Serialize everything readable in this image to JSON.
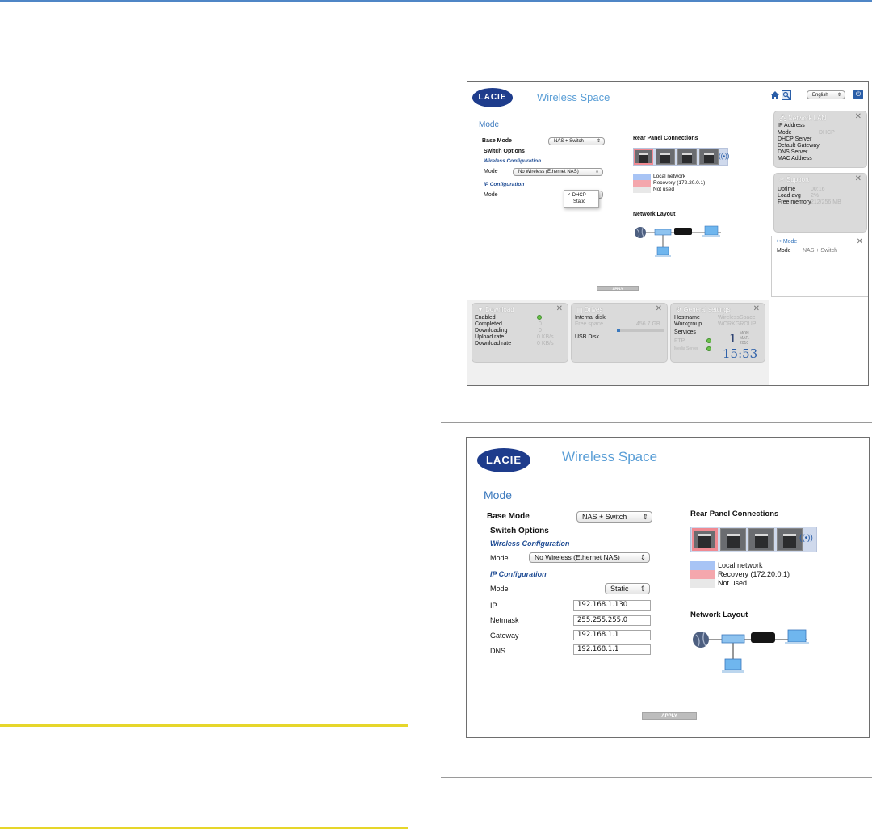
{
  "brand": {
    "logo": "LACIE",
    "product": "Wireless Space"
  },
  "colors": {
    "accent": "#3a78bd",
    "logo_bg": "#1e3c8c",
    "local_network": "#a8c4f5",
    "recovery": "#f4a7ad",
    "not_used": "#e8e8e8",
    "caution_rule": "#e6d62a"
  },
  "top": {
    "header": {
      "language": "English",
      "icons": [
        "home-icon",
        "search-icon",
        "power-icon"
      ]
    },
    "mode_title": "Mode",
    "base_mode_label": "Base Mode",
    "base_mode_value": "NAS + Switch",
    "switch_options": "Switch Options",
    "wireless_configuration": "Wireless Configuration",
    "mode_label": "Mode",
    "wireless_mode_value": "No Wireless (Ethernet NAS)",
    "ip_configuration": "IP Configuration",
    "ip_mode_label": "Mode",
    "ip_mode_options": [
      "DHCP",
      "Static"
    ],
    "ip_mode_selected": "DHCP",
    "rear_panel": "Rear Panel Connections",
    "legend": [
      "Local network",
      "Recovery (172.20.0.1)",
      "Not used"
    ],
    "network_layout": "Network Layout",
    "apply": "APPLY",
    "widgets": {
      "network_lan": {
        "title": "Network LAN",
        "rows": [
          "IP Address",
          "Mode",
          "DHCP Server",
          "Default Gateway",
          "DNS Server",
          "MAC Address"
        ],
        "mode_value": "DHCP"
      },
      "support": {
        "title": "Support",
        "rows": [
          "Uptime",
          "Load avg",
          "Free memory"
        ],
        "values": [
          "00:16",
          "2%",
          "212/256 MB"
        ]
      },
      "mode": {
        "title": "Mode",
        "row": "Mode",
        "value": "NAS + Switch"
      },
      "download": {
        "title": "Download",
        "rows": [
          "Enabled",
          "Completed",
          "Downloading",
          "Upload rate",
          "Download rate"
        ],
        "values": [
          "",
          "0",
          "0",
          "0 KB/s",
          "0 KB/s"
        ]
      },
      "drives": {
        "title": "Drives",
        "rows": [
          "Internal disk",
          "Free space",
          "USB Disk"
        ],
        "free_space": "456.7 GB"
      },
      "general": {
        "title": "General settings",
        "rows": [
          "Hostname",
          "Workgroup",
          "Services",
          "FTP",
          "Media Server"
        ],
        "hostname": "WirelessSpace",
        "workgroup": "WORKGROUP",
        "day": "1",
        "weekday": "MON.",
        "month": "MAR.",
        "year": "2010",
        "time": "15:53"
      }
    }
  },
  "bottom": {
    "mode_title": "Mode",
    "base_mode_label": "Base Mode",
    "base_mode_value": "NAS + Switch",
    "switch_options": "Switch Options",
    "wireless_configuration": "Wireless Configuration",
    "mode_label": "Mode",
    "wireless_mode_value": "No Wireless (Ethernet NAS)",
    "ip_configuration": "IP Configuration",
    "ip_mode_label": "Mode",
    "ip_mode_value": "Static",
    "ip_label": "IP",
    "ip_value": "192.168.1.130",
    "netmask_label": "Netmask",
    "netmask_value": "255.255.255.0",
    "gateway_label": "Gateway",
    "gateway_value": "192.168.1.1",
    "dns_label": "DNS",
    "dns_value": "192.168.1.1",
    "rear_panel": "Rear Panel Connections",
    "legend": [
      "Local network",
      "Recovery (172.20.0.1)",
      "Not used"
    ],
    "network_layout": "Network Layout",
    "apply": "APPLY"
  }
}
